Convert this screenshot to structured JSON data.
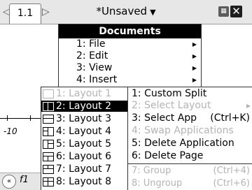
{
  "tabbar": {
    "nav_left": "◁",
    "tab_label": "1.1",
    "nav_right": "▷",
    "doc_title": "*Unsaved",
    "title_arrow": "▼",
    "battery_icon_text": "▦",
    "close_icon_text": "✕"
  },
  "graph": {
    "axis_label": "-10",
    "collapse_icon_text": "«",
    "fx_label": "f1"
  },
  "documents_menu": {
    "header": "Documents",
    "items": [
      {
        "label": "1: File"
      },
      {
        "label": "2: Edit"
      },
      {
        "label": "3: View"
      },
      {
        "label": "4: Insert"
      }
    ]
  },
  "layout_menu": {
    "items": [
      {
        "label": "1: Layout 1",
        "icon": "layout-1-icon",
        "disabled": true
      },
      {
        "label": "2: Layout 2",
        "icon": "layout-2-icon",
        "selected": true
      },
      {
        "label": "3: Layout 3",
        "icon": "layout-3-icon"
      },
      {
        "label": "4: Layout 4",
        "icon": "layout-4-icon"
      },
      {
        "label": "5: Layout 5",
        "icon": "layout-5-icon"
      },
      {
        "label": "6: Layout 6",
        "icon": "layout-6-icon"
      },
      {
        "label": "7: Layout 7",
        "icon": "layout-7-icon"
      },
      {
        "label": "8: Layout 8",
        "icon": "layout-8-icon"
      }
    ]
  },
  "page_menu": {
    "items": [
      {
        "label": "1: Custom Split"
      },
      {
        "label": "2: Select Layout",
        "disabled": true
      },
      {
        "label": "3: Select App",
        "shortcut": "(Ctrl+K)"
      },
      {
        "label": "4: Swap Applications",
        "disabled": true
      },
      {
        "label": "5: Delete Application"
      },
      {
        "label": "6: Delete Page"
      },
      {
        "label": "7: Group",
        "shortcut": "(Ctrl+4)",
        "disabled": true
      },
      {
        "label": "8: Ungroup",
        "shortcut": "(Ctrl+6)",
        "disabled": true
      }
    ]
  }
}
